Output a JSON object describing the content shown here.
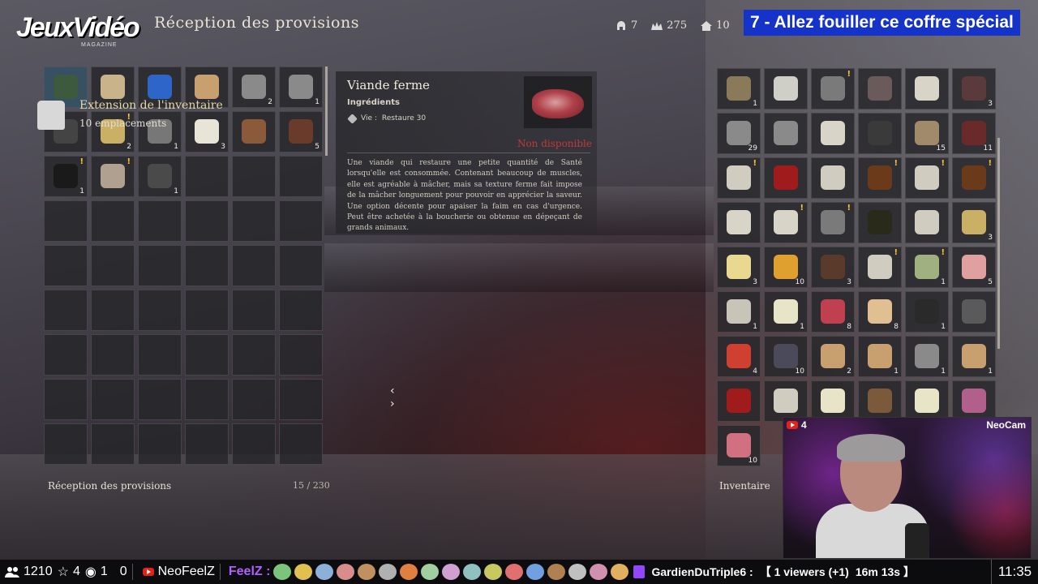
{
  "header": {
    "logo": "JeuxVidéo",
    "logo_sub": "MAGAZINE",
    "title": "Réception des provisions",
    "resources": [
      {
        "icon": "helmet-icon",
        "value": "7"
      },
      {
        "icon": "crowns-icon",
        "value": "275"
      },
      {
        "icon": "house-icon",
        "value": "10"
      }
    ],
    "overlay_title": "7 - Allez fouiller ce coffre spécial"
  },
  "left_panel": {
    "tooltip_title": "Extension de l'inventaire",
    "tooltip_subtitle": "10 emplacements",
    "footer_label": "Réception des provisions",
    "footer_count": "15 / 230",
    "slots": [
      {
        "icon": "sack-icon",
        "qty": "",
        "color": "#3e5a3e",
        "selected": true
      },
      {
        "icon": "bottle-icon",
        "qty": "",
        "color": "#c9b38a"
      },
      {
        "icon": "orb-icon",
        "qty": "",
        "color": "#2d66c8"
      },
      {
        "icon": "pouch-icon",
        "qty": "",
        "color": "#c8a070"
      },
      {
        "icon": "mace-icon",
        "qty": "2",
        "color": "#8a8a8a"
      },
      {
        "icon": "mace-icon",
        "qty": "1",
        "color": "#8a8a8a"
      },
      {
        "icon": "helmet-icon",
        "qty": "",
        "color": "#444"
      },
      {
        "icon": "sack-icon",
        "qty": "2",
        "color": "#c9b064",
        "new": true
      },
      {
        "icon": "crossbow-icon",
        "qty": "1",
        "color": "#777"
      },
      {
        "icon": "cloth-icon",
        "qty": "3",
        "color": "#e8e4d8"
      },
      {
        "icon": "hair-icon",
        "qty": "",
        "color": "#8a5a3a"
      },
      {
        "icon": "leg-icon",
        "qty": "5",
        "color": "#6a3a2a"
      },
      {
        "icon": "cauldron-icon",
        "qty": "1",
        "color": "#1a1a1a",
        "new": true
      },
      {
        "icon": "hammer-icon",
        "qty": "",
        "color": "#b0a090",
        "new": true
      },
      {
        "icon": "chest-icon",
        "qty": "1",
        "color": "#4a4a4a"
      }
    ],
    "total_slots": 54
  },
  "detail": {
    "name": "Viande ferme",
    "category": "Ingrédients",
    "stat_label": "Vie :",
    "stat_value": "Restaure 30",
    "status": "Non disponible",
    "description": "Une viande qui restaure une petite quantité de Santé lorsqu'elle est consommée. Contenant beaucoup de muscles, elle est agréable à mâcher, mais sa texture ferme fait impose de la mâcher longuement pour pouvoir en apprécier la saveur. Une option décente pour apaiser la faim en cas d'urgence. Peut être achetée à la boucherie ou obtenue en dépeçant de grands animaux.",
    "image_icon": "meat-icon"
  },
  "right_panel": {
    "footer_label": "Inventaire",
    "slots": [
      {
        "icon": "bottle-icon",
        "qty": "1",
        "color": "#8a7a5a"
      },
      {
        "icon": "paper-icon",
        "qty": "",
        "color": "#cfcfc8"
      },
      {
        "icon": "armor-icon",
        "qty": "",
        "color": "#7a7a7a",
        "new": true
      },
      {
        "icon": "boots-icon",
        "qty": "",
        "color": "#6a5a5a"
      },
      {
        "icon": "paper-icon",
        "qty": "",
        "color": "#d8d4c8"
      },
      {
        "icon": "leg-icon",
        "qty": "3",
        "color": "#5a3a3a"
      },
      {
        "icon": "sword-icon",
        "qty": "29",
        "color": "#8a8a8a"
      },
      {
        "icon": "mace-icon",
        "qty": "",
        "color": "#8a8a8a"
      },
      {
        "icon": "map-icon",
        "qty": "",
        "color": "#d8d4c8"
      },
      {
        "icon": "hat-icon",
        "qty": "",
        "color": "#3a3a3a"
      },
      {
        "icon": "wood-icon",
        "qty": "15",
        "color": "#a08a6a"
      },
      {
        "icon": "leg-icon",
        "qty": "11",
        "color": "#6a2a2a"
      },
      {
        "icon": "paper-icon",
        "qty": "",
        "color": "#d0ccc0",
        "new": true
      },
      {
        "icon": "book-icon",
        "qty": "",
        "color": "#a01c1c"
      },
      {
        "icon": "paper-icon",
        "qty": "",
        "color": "#d0ccc0"
      },
      {
        "icon": "book-icon",
        "qty": "",
        "color": "#6a3a1a",
        "new": true
      },
      {
        "icon": "paper-icon",
        "qty": "",
        "color": "#d0ccc0",
        "new": true
      },
      {
        "icon": "book-icon",
        "qty": "",
        "color": "#6a3a1a",
        "new": true
      },
      {
        "icon": "paper-icon",
        "qty": "",
        "color": "#d8d4c8"
      },
      {
        "icon": "portrait-icon",
        "qty": "",
        "color": "#d8d4c8",
        "new": true
      },
      {
        "icon": "axe-icon",
        "qty": "",
        "color": "#7a7a7a",
        "new": true
      },
      {
        "icon": "pot-icon",
        "qty": "",
        "color": "#2a2a1a"
      },
      {
        "icon": "paper-icon",
        "qty": "",
        "color": "#d0ccc0"
      },
      {
        "icon": "sack-icon",
        "qty": "3",
        "color": "#c9b064"
      },
      {
        "icon": "cheese-icon",
        "qty": "3",
        "color": "#e8d890"
      },
      {
        "icon": "bowl-icon",
        "qty": "10",
        "color": "#e0a030"
      },
      {
        "icon": "barrel-icon",
        "qty": "3",
        "color": "#5a3a2a"
      },
      {
        "icon": "paper-icon",
        "qty": "",
        "color": "#d0ccc0",
        "new": true
      },
      {
        "icon": "herb-icon",
        "qty": "1",
        "color": "#a0b080",
        "new": true
      },
      {
        "icon": "feather-icon",
        "qty": "5",
        "color": "#e0a0a0"
      },
      {
        "icon": "paper-icon",
        "qty": "1",
        "color": "#c8c4b8"
      },
      {
        "icon": "plate-icon",
        "qty": "1",
        "color": "#e8e4c8"
      },
      {
        "icon": "meat-icon",
        "qty": "8",
        "color": "#c04050"
      },
      {
        "icon": "icecream-icon",
        "qty": "8",
        "color": "#e0c090"
      },
      {
        "icon": "bomb-icon",
        "qty": "1",
        "color": "#2a2a2a"
      },
      {
        "icon": "gear-icon",
        "qty": "",
        "color": "#5a5a5a"
      },
      {
        "icon": "apple-icon",
        "qty": "4",
        "color": "#d04030"
      },
      {
        "icon": "ore-icon",
        "qty": "10",
        "color": "#4a4a5a"
      },
      {
        "icon": "pouch-icon",
        "qty": "2",
        "color": "#c8a070"
      },
      {
        "icon": "pouch-icon",
        "qty": "1",
        "color": "#c8a070"
      },
      {
        "icon": "mace-icon",
        "qty": "1",
        "color": "#8a8a8a"
      },
      {
        "icon": "pouch-icon",
        "qty": "1",
        "color": "#c8a070"
      },
      {
        "icon": "book-icon",
        "qty": "",
        "color": "#a01c1c"
      },
      {
        "icon": "paper-icon",
        "qty": "",
        "color": "#d0ccc0"
      },
      {
        "icon": "plate-icon",
        "qty": "",
        "color": "#e8e4c8"
      },
      {
        "icon": "wood-icon",
        "qty": "",
        "color": "#7a5a3a"
      },
      {
        "icon": "plate-icon",
        "qty": "",
        "color": "#e8e4c8"
      },
      {
        "icon": "flower-icon",
        "qty": "",
        "color": "#b0608a"
      },
      {
        "icon": "meat-icon",
        "qty": "10",
        "color": "#d07080"
      }
    ]
  },
  "webcam": {
    "live_count": "4",
    "label": "NeoCam"
  },
  "bottom_bar": {
    "viewers": "1210",
    "favorites": "4",
    "watching": "1",
    "extra": "0",
    "channel": "NeoFeelZ",
    "emote_prefix": "FeelZ :",
    "chat_user": "GardienDuTriple6 :",
    "viewers_text": "【 1 viewers (+1)",
    "duration": "16m 13s 】",
    "clock": "11:35"
  }
}
